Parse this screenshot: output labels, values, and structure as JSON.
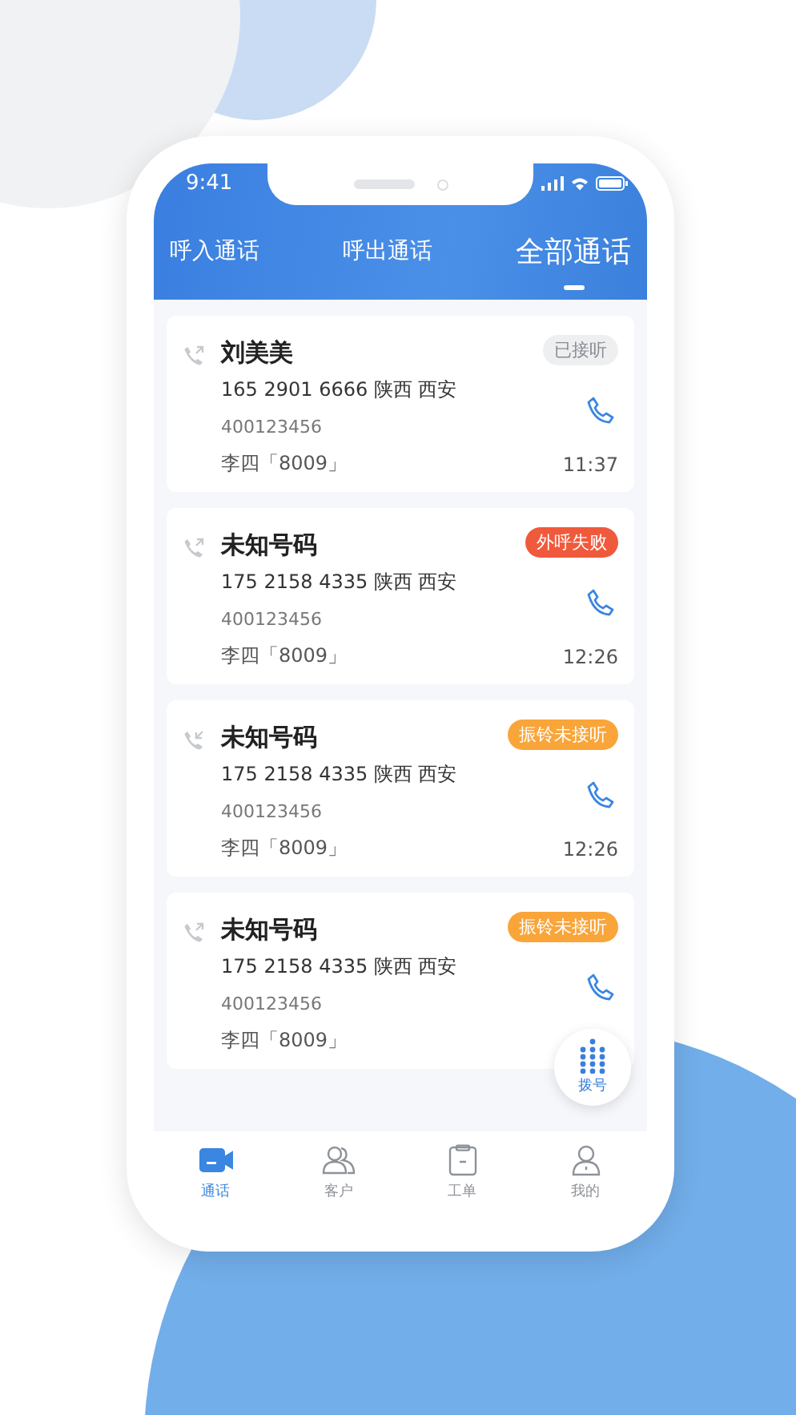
{
  "status_bar": {
    "time": "9:41"
  },
  "tabs": [
    {
      "label": "呼入通话",
      "selected": false
    },
    {
      "label": "呼出通话",
      "selected": false
    },
    {
      "label": "全部通话",
      "selected": true
    }
  ],
  "calls": [
    {
      "name": "刘美美",
      "kind": "outgoing",
      "status": {
        "kind": "answered",
        "text": "已接听"
      },
      "number": "165 2901 6666 陕西 西安",
      "line": "400123456",
      "agent": "李四「8009」",
      "time": "11:37"
    },
    {
      "name": "未知号码",
      "kind": "outgoing",
      "status": {
        "kind": "failed",
        "text": "外呼失败"
      },
      "number": "175 2158 4335 陕西 西安",
      "line": "400123456",
      "agent": "李四「8009」",
      "time": "12:26"
    },
    {
      "name": "未知号码",
      "kind": "incoming",
      "status": {
        "kind": "missed",
        "text": "振铃未接听"
      },
      "number": "175 2158 4335 陕西 西安",
      "line": "400123456",
      "agent": "李四「8009」",
      "time": "12:26"
    },
    {
      "name": "未知号码",
      "kind": "outgoing",
      "status": {
        "kind": "missed",
        "text": "振铃未接听"
      },
      "number": "175 2158 4335 陕西 西安",
      "line": "400123456",
      "agent": "李四「8009」"
    }
  ],
  "dial_button": {
    "label": "拨号"
  },
  "bottom_nav": [
    {
      "label": "通话",
      "selected": true
    },
    {
      "label": "客户",
      "selected": false
    },
    {
      "label": "工单",
      "selected": false
    },
    {
      "label": "我的",
      "selected": false
    }
  ]
}
